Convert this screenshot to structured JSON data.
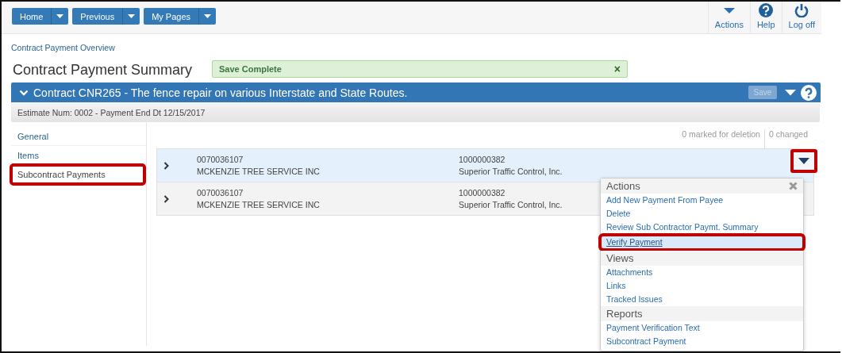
{
  "nav_buttons": [
    {
      "label": "Home"
    },
    {
      "label": "Previous"
    },
    {
      "label": "My Pages"
    }
  ],
  "toolbar": [
    {
      "label": "Actions",
      "kind": "caret"
    },
    {
      "label": "Help",
      "kind": "help"
    },
    {
      "label": "Log off",
      "kind": "power"
    }
  ],
  "breadcrumb": "Contract Payment Overview",
  "title": "Contract Payment Summary",
  "alert": {
    "text": "Save Complete",
    "close": "×"
  },
  "panel": {
    "title": "Contract CNR265 - The fence repair on various Interstate and State Routes.",
    "expanded": true,
    "save_button": {
      "label": "Save",
      "disabled": true
    },
    "subtitle": "Estimate Num: 0002 - Payment End Dt 12/15/2017"
  },
  "sidebar": {
    "items": [
      {
        "label": "General",
        "selected": false,
        "annotated": false
      },
      {
        "label": "Items",
        "selected": false,
        "annotated": false
      },
      {
        "label": "Subcontract Payments",
        "selected": true,
        "annotated": true
      }
    ]
  },
  "counts": [
    "0 marked for deletion",
    "0 changed"
  ],
  "rows": [
    {
      "expanded": false,
      "selected": true,
      "column_1": [
        "0070036107",
        "MCKENZIE TREE SERVICE INC"
      ],
      "column_2": [
        "1000000382",
        "Superior Traffic Control, Inc."
      ]
    },
    {
      "expanded": false,
      "selected": false,
      "column_1": [
        "0070036107",
        "MCKENZIE TREE SERVICE INC"
      ],
      "column_2": [
        "1000000382",
        "Superior Traffic Control, Inc."
      ]
    }
  ],
  "row_menu_button": {
    "annotated": true
  },
  "menu": {
    "items": [
      {
        "kind": "header",
        "label": "Actions"
      },
      {
        "kind": "item",
        "label": "Add New Payment From Payee",
        "selected": false,
        "annotated": false
      },
      {
        "kind": "item",
        "label": "Delete",
        "selected": false,
        "annotated": false
      },
      {
        "kind": "item",
        "label": "Review Sub Contractor Paymt. Summary",
        "selected": false,
        "annotated": false
      },
      {
        "kind": "item",
        "label": "Verify Payment",
        "selected": true,
        "annotated": true
      },
      {
        "kind": "header",
        "label": "Views"
      },
      {
        "kind": "item",
        "label": "Attachments",
        "selected": false,
        "annotated": false
      },
      {
        "kind": "item",
        "label": "Links",
        "selected": false,
        "annotated": false
      },
      {
        "kind": "item",
        "label": "Tracked Issues",
        "selected": false,
        "annotated": false
      },
      {
        "kind": "header",
        "label": "Reports"
      },
      {
        "kind": "item",
        "label": "Payment Verification Text",
        "selected": false,
        "annotated": false
      },
      {
        "kind": "item",
        "label": "Subcontract Payment",
        "selected": false,
        "annotated": false
      }
    ]
  }
}
